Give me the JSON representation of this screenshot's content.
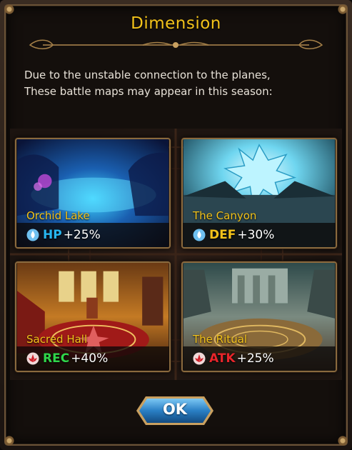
{
  "dialog": {
    "title": "Dimension",
    "description_lines": [
      "Due to the unstable connection to the planes,",
      "These battle maps may appear in this season:"
    ]
  },
  "maps": [
    {
      "name": "Orchid Lake",
      "stat": "HP",
      "value": "+25%",
      "stat_color": "#27b6f0",
      "icon": "water-drop-icon"
    },
    {
      "name": "The Canyon",
      "stat": "DEF",
      "value": "+30%",
      "stat_color": "#f2c21a",
      "icon": "water-drop-icon"
    },
    {
      "name": "Sacred Hall",
      "stat": "REC",
      "value": "+40%",
      "stat_color": "#2fd64a",
      "icon": "lotus-icon"
    },
    {
      "name": "The Ritual",
      "stat": "ATK",
      "value": "+25%",
      "stat_color": "#e8252a",
      "icon": "lotus-icon"
    }
  ],
  "ok_button": {
    "label": "OK"
  },
  "colors": {
    "title": "#f2c21a",
    "frame_gold": "#8a6a3e",
    "button_blue": "#2a7fc4"
  }
}
